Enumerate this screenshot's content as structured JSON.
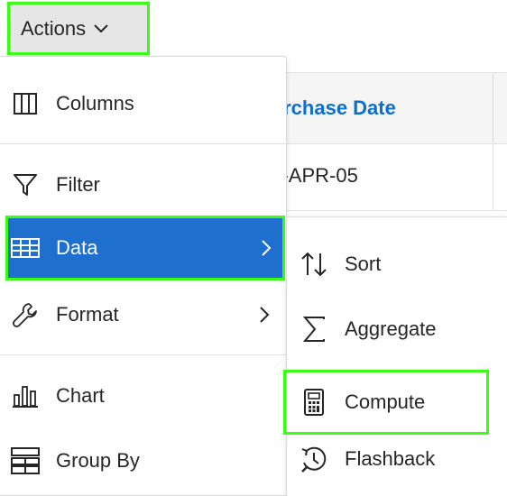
{
  "actions_button": {
    "label": "Actions",
    "icon": "chevron-down-icon"
  },
  "report": {
    "column_header": "Purchase Date",
    "first_cell": "01-APR-05",
    "header_color": "#0b6fd0"
  },
  "menu": {
    "items": [
      {
        "label": "Columns",
        "icon": "columns-icon"
      },
      {
        "label": "Filter",
        "icon": "filter-icon"
      },
      {
        "label": "Data",
        "icon": "table-grid-icon",
        "active": true,
        "has_submenu": true
      },
      {
        "label": "Format",
        "icon": "wrench-icon",
        "has_submenu": true
      },
      {
        "label": "Chart",
        "icon": "bar-chart-icon"
      },
      {
        "label": "Group By",
        "icon": "group-by-icon"
      }
    ],
    "active_color": "#1f6fcf",
    "highlight_color": "#39ff14"
  },
  "submenu": {
    "items": [
      {
        "label": "Sort",
        "icon": "sort-arrows-icon"
      },
      {
        "label": "Aggregate",
        "icon": "sigma-icon"
      },
      {
        "label": "Compute",
        "icon": "calculator-icon",
        "highlighted": true
      },
      {
        "label": "Flashback",
        "icon": "history-clock-icon"
      }
    ]
  }
}
